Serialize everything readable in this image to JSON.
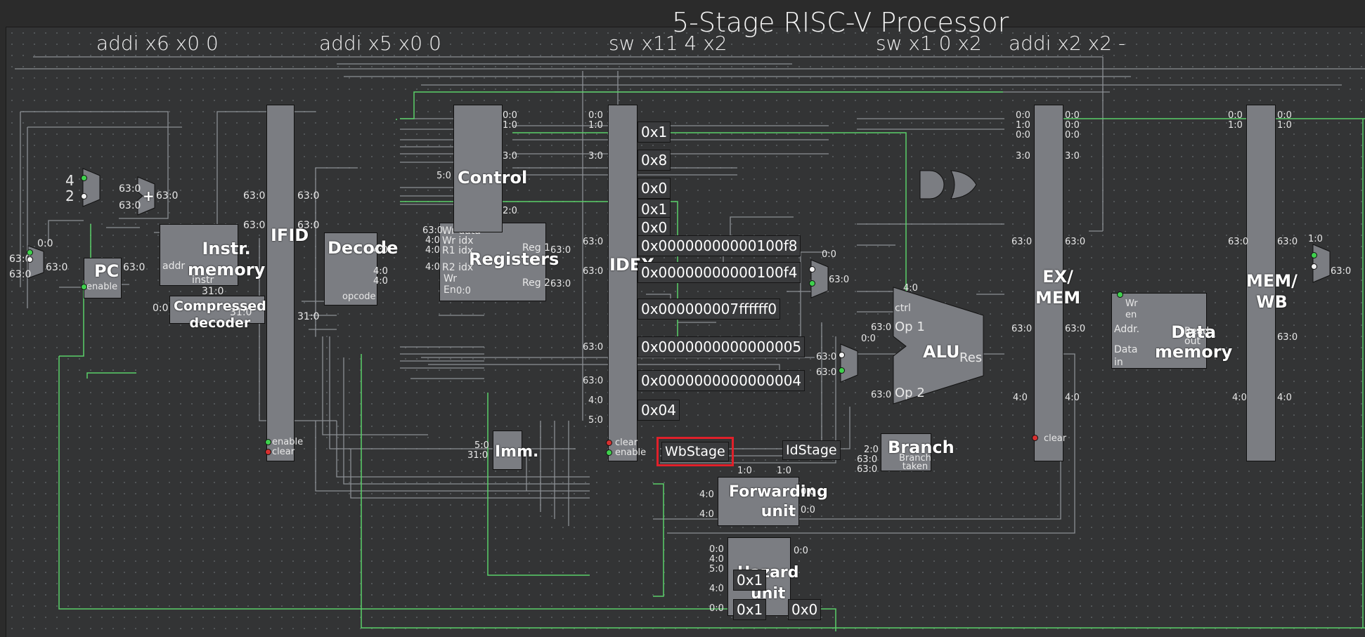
{
  "title": "5-Stage RISC-V Processor",
  "stages": [
    {
      "id": "if",
      "label": "addi x6 x0 0"
    },
    {
      "id": "id",
      "label": "addi x5 x0 0"
    },
    {
      "id": "ex",
      "label": "sw x11 4 x2"
    },
    {
      "id": "mem",
      "label": "sw x1 0 x2"
    },
    {
      "id": "wb",
      "label": "addi x2 x2 -"
    }
  ],
  "components": {
    "pc": {
      "label": "PC",
      "port_enable": "enable"
    },
    "instr_memory": {
      "label": "Instr.\nmemory",
      "port_addr": "addr",
      "port_instr": "instr"
    },
    "compressed_decoder": {
      "label": "Compressed\ndecoder"
    },
    "ifid": {
      "label": "IFID",
      "port_enable": "enable",
      "port_clear": "clear"
    },
    "decode": {
      "label": "Decode",
      "port_opcode": "opcode"
    },
    "registers": {
      "label": "Registers",
      "port_wr_data": "Wr data",
      "port_wr_idx": "Wr idx",
      "port_r1_idx": "R1 idx",
      "port_r2_idx": "R2 idx",
      "port_wr": "Wr",
      "port_en": "En",
      "port_reg1": "Reg 1",
      "port_reg2": "Reg 2"
    },
    "control": {
      "label": "Control"
    },
    "imm": {
      "label": "Imm."
    },
    "idex": {
      "label": "IDEX",
      "port_clear": "clear",
      "port_enable": "enable"
    },
    "alu": {
      "label": "ALU",
      "port_ctrl": "ctrl",
      "port_op1": "Op 1",
      "port_op2": "Op 2",
      "port_res": "Res"
    },
    "branch": {
      "label": "Branch",
      "port_taken": "Branch\ntaken"
    },
    "exmem": {
      "label": "EX/\nMEM",
      "port_clear": "clear"
    },
    "data_memory": {
      "label": "Data\nmemory",
      "port_wr": "Wr",
      "port_en": "en",
      "port_addr": "Addr.",
      "port_data_in": "Data\nin",
      "port_read_out": "Read\nout"
    },
    "memwb": {
      "label": "MEM/\nWB"
    },
    "forwarding_unit": {
      "label": "Forwarding\nunit"
    },
    "hazard_unit": {
      "label": "Hazard\nunit"
    },
    "adder": {
      "label": "+"
    }
  },
  "consts": {
    "four": "4",
    "two": "2"
  },
  "probes": {
    "idex_v1": "0x1",
    "idex_v2": "0x8",
    "idex_v3": "0x0",
    "idex_v4": "0x1",
    "idex_v5": "0x0",
    "pc_value": "0x00000000000100f8",
    "pc4_value": "0x00000000000100f4",
    "reg1_value": "0x000000007ffffff0",
    "reg2_value": "0x0000000000000005",
    "imm_value": "0x0000000000000004",
    "rd_value": "0x04",
    "wbstage": "WbStage",
    "idstage": "IdStage",
    "hz_v1": "0x1",
    "hz_v2": "0x1",
    "hz_v3": "0x0"
  },
  "port_labels": {
    "b0_0": "0:0",
    "b1_0": "1:0",
    "b3_0": "3:0",
    "b4_0": "4:0",
    "b5_0": "5:0",
    "b2_0": "2:0",
    "b31_0": "31:0",
    "b63_0": "63:0"
  },
  "colors": {
    "wire": "#8c8f94",
    "active_wire": "#5bd06a",
    "component": "#7b7d82",
    "background": "#333435",
    "highlight": "#e0202a"
  }
}
